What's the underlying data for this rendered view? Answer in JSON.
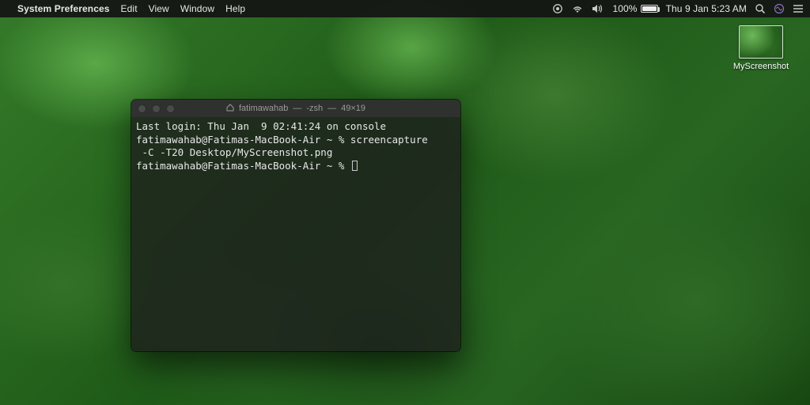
{
  "menubar": {
    "app_name": "System Preferences",
    "items": [
      "Edit",
      "View",
      "Window",
      "Help"
    ],
    "battery_percent": "100%",
    "clock": "Thu 9 Jan  5:23 AM"
  },
  "desktop_file": {
    "label": "MyScreenshot"
  },
  "terminal": {
    "title_user": "fatimawahab",
    "title_shell": "-zsh",
    "title_size": "49×19",
    "lines": [
      "Last login: Thu Jan  9 02:41:24 on console",
      "fatimawahab@Fatimas-MacBook-Air ~ % screencapture",
      " -C -T20 Desktop/MyScreenshot.png",
      "fatimawahab@Fatimas-MacBook-Air ~ % "
    ]
  }
}
